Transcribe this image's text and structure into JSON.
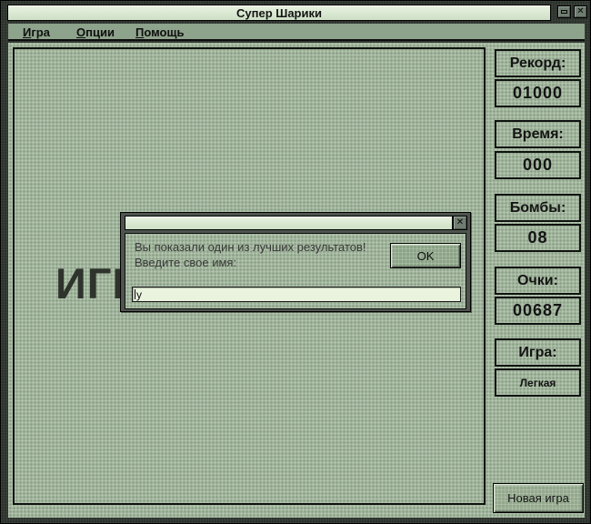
{
  "window": {
    "title": "Супер Шарики",
    "close_glyph": "✕"
  },
  "menu": {
    "items": [
      {
        "first": "И",
        "rest": "гра"
      },
      {
        "first": "О",
        "rest": "пции"
      },
      {
        "first": "П",
        "rest": "омощь"
      }
    ]
  },
  "game": {
    "overlay_text_partial": "ИГР"
  },
  "sidebar": {
    "stats": [
      {
        "label": "Рекорд:",
        "value": "01000"
      },
      {
        "label": "Время:",
        "value": "000"
      },
      {
        "label": "Бомбы:",
        "value": "08"
      },
      {
        "label": "Очки:",
        "value": "00687"
      },
      {
        "label": "Игра:",
        "value": "Легкая"
      }
    ],
    "new_game_label": "Новая игра"
  },
  "dialog": {
    "close_glyph": "✕",
    "message_line1": "Вы показали один из лучших результатов!",
    "message_line2": "Введите свое имя:",
    "ok_label": "OK",
    "input_value": "y"
  },
  "colors": {
    "frame": "#2b312b",
    "titlebar_strip": "#d9e8d1",
    "menubar": "#8da38b",
    "texture_base": "#9fb49a",
    "box_border": "#0f120f",
    "button_face": "#93a88d",
    "input_bg": "#e9f3de",
    "text_dark": "#141414"
  }
}
